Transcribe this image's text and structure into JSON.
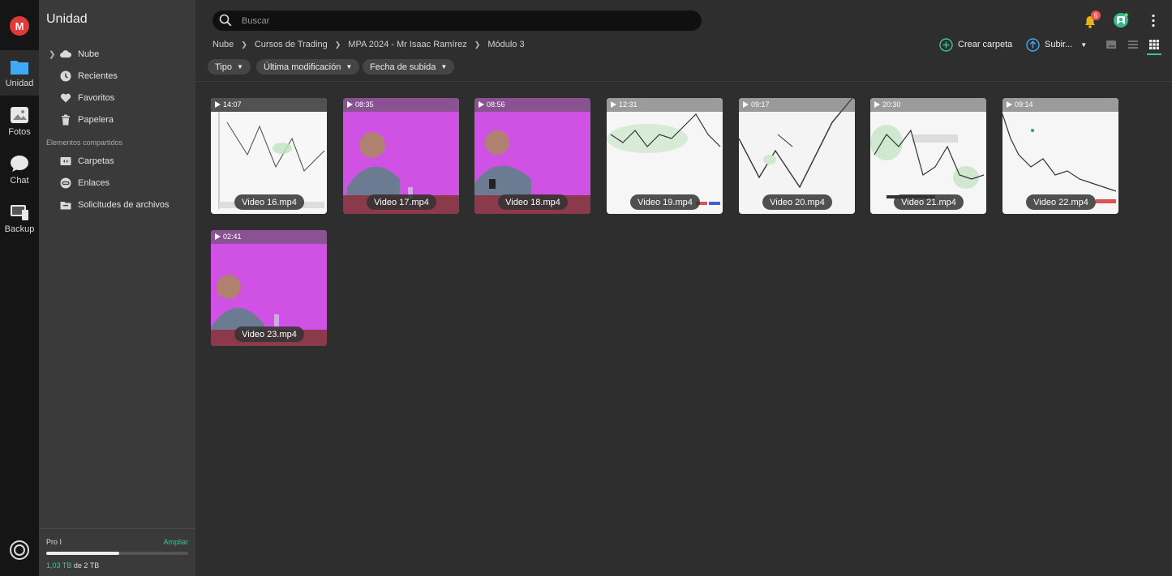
{
  "rail": {
    "logo": "M",
    "items": [
      {
        "label": "Unidad",
        "icon": "folder-icon"
      },
      {
        "label": "Fotos",
        "icon": "photo-icon"
      },
      {
        "label": "Chat",
        "icon": "chat-icon"
      },
      {
        "label": "Backup",
        "icon": "backup-icon"
      }
    ]
  },
  "sidebar": {
    "title": "Unidad",
    "items": [
      {
        "label": "Nube",
        "icon": "cloud-icon"
      },
      {
        "label": "Recientes",
        "icon": "clock-icon"
      },
      {
        "label": "Favoritos",
        "icon": "heart-icon"
      },
      {
        "label": "Papelera",
        "icon": "trash-icon"
      }
    ],
    "shared_section": "Elementos compartidos",
    "shared_items": [
      {
        "label": "Carpetas",
        "icon": "shared-folder-icon"
      },
      {
        "label": "Enlaces",
        "icon": "link-icon"
      },
      {
        "label": "Solicitudes de archivos",
        "icon": "file-request-icon"
      }
    ],
    "storage": {
      "plan": "Pro I",
      "upgrade": "Ampliar",
      "used": "1,03 TB",
      "of": " de 2 TB",
      "fraction": 0.515
    }
  },
  "topbar": {
    "search_placeholder": "Buscar",
    "notifications_count": "6"
  },
  "breadcrumb": [
    "Nube",
    "Cursos de Trading",
    "MPA 2024 - Mr Isaac Ramírez",
    "Módulo 3"
  ],
  "actions": {
    "create_folder": "Crear carpeta",
    "upload": "Subir..."
  },
  "filters": [
    "Tipo",
    "Última modificación",
    "Fecha de subida"
  ],
  "files": [
    {
      "name": "Video 16.mp4",
      "duration": "14:07",
      "thumb": "chart"
    },
    {
      "name": "Video 17.mp4",
      "duration": "08:35",
      "thumb": "person"
    },
    {
      "name": "Video 18.mp4",
      "duration": "08:56",
      "thumb": "person"
    },
    {
      "name": "Video 19.mp4",
      "duration": "12:31",
      "thumb": "chart"
    },
    {
      "name": "Video 20.mp4",
      "duration": "09:17",
      "thumb": "chart"
    },
    {
      "name": "Video 21.mp4",
      "duration": "20:30",
      "thumb": "chart"
    },
    {
      "name": "Video 22.mp4",
      "duration": "09:14",
      "thumb": "chart"
    },
    {
      "name": "Video 23.mp4",
      "duration": "02:41",
      "thumb": "person"
    }
  ],
  "colors": {
    "accent": "#39c5a0",
    "logo": "#e03a3a",
    "thumb_purple": "#d154e6"
  }
}
